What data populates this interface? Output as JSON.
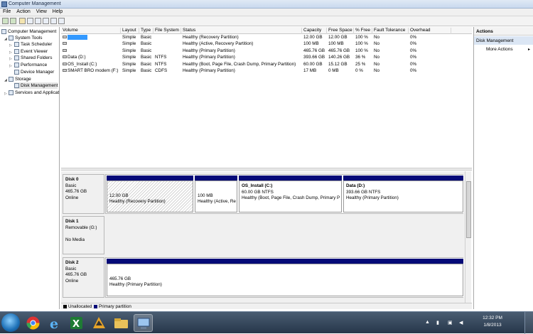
{
  "window": {
    "title": "Computer Management"
  },
  "menu": [
    "File",
    "Action",
    "View",
    "Help"
  ],
  "toolbar": [
    "back-icon",
    "forward-icon",
    "up-icon",
    "properties-icon",
    "help-icon",
    "show-hide-icon",
    "export-icon",
    "refresh-icon"
  ],
  "tree": [
    {
      "label": "Computer Management",
      "level": 0,
      "expanded": true
    },
    {
      "label": "System Tools",
      "level": 1,
      "expanded": true
    },
    {
      "label": "Task Scheduler",
      "level": 2
    },
    {
      "label": "Event Viewer",
      "level": 2
    },
    {
      "label": "Shared Folders",
      "level": 2
    },
    {
      "label": "Performance",
      "level": 2
    },
    {
      "label": "Device Manager",
      "level": 2
    },
    {
      "label": "Storage",
      "level": 1,
      "expanded": true
    },
    {
      "label": "Disk Management",
      "level": 2,
      "selected": true
    },
    {
      "label": "Services and Applicat",
      "level": 1
    }
  ],
  "volume_list": {
    "columns": [
      "Volume",
      "Layout",
      "Type",
      "File System",
      "Status",
      "Capacity",
      "Free Space",
      "% Free",
      "Fault Tolerance",
      "Overhead"
    ],
    "rows": [
      [
        "",
        "Simple",
        "Basic",
        "",
        "Healthy (Recovery Partition)",
        "12.00 GB",
        "12.00 GB",
        "100 %",
        "No",
        "0%"
      ],
      [
        "",
        "Simple",
        "Basic",
        "",
        "Healthy (Active, Recovery Partition)",
        "100 MB",
        "100 MB",
        "100 %",
        "No",
        "0%"
      ],
      [
        "",
        "Simple",
        "Basic",
        "",
        "Healthy (Primary Partition)",
        "465.76 GB",
        "465.76 GB",
        "100 %",
        "No",
        "0%"
      ],
      [
        "Data (D:)",
        "Simple",
        "Basic",
        "NTFS",
        "Healthy (Primary Partition)",
        "393.66 GB",
        "140.26 GB",
        "36 %",
        "No",
        "0%"
      ],
      [
        "OS_Install (C:)",
        "Simple",
        "Basic",
        "NTFS",
        "Healthy (Boot, Page File, Crash Dump, Primary Partition)",
        "60.00 GB",
        "15.12 GB",
        "25 %",
        "No",
        "0%"
      ],
      [
        "SMART BRO modem (F:)",
        "Simple",
        "Basic",
        "CDFS",
        "Healthy (Primary Partition)",
        "17 MB",
        "0 MB",
        "0 %",
        "No",
        "0%"
      ]
    ]
  },
  "disks": [
    {
      "name": "Disk 0",
      "type": "Basic",
      "size": "465.76 GB",
      "status": "Online",
      "volumes": [
        {
          "title": "",
          "size": "12.00 GB",
          "status": "Healthy (Recovery Partition)",
          "selected": true
        },
        {
          "title": "",
          "size": "100 MB",
          "status": "Healthy (Active, Re"
        },
        {
          "title": "OS_Install  (C:)",
          "size": "60.00 GB NTFS",
          "status": "Healthy (Boot, Page File, Crash Dump, Primary P"
        },
        {
          "title": "Data  (D:)",
          "size": "393.66 GB NTFS",
          "status": "Healthy (Primary Partition)"
        }
      ]
    },
    {
      "name": "Disk 1",
      "type": "Removable (G:)",
      "size": "",
      "status": "No Media",
      "volumes": []
    },
    {
      "name": "Disk 2",
      "type": "Basic",
      "size": "465.76 GB",
      "status": "Online",
      "volumes": [
        {
          "title": "",
          "size": "465.76 GB",
          "status": "Healthy (Primary Partition)"
        }
      ]
    }
  ],
  "legend": [
    {
      "label": "Unallocated",
      "color": "#000000"
    },
    {
      "label": "Primary partition",
      "color": "#050a78"
    }
  ],
  "actions": {
    "header": "Actions",
    "section": "Disk Management",
    "item": "More Actions",
    "arrow": "▸"
  },
  "taskbar": {
    "apps": [
      "chrome-icon",
      "internet-explorer-icon",
      "excel-icon",
      "winamp-icon",
      "windows-explorer-icon",
      "computer-management-icon"
    ],
    "time": "12:32 PM",
    "date": "1/8/2013",
    "tray_icons": [
      "arrow-up-icon",
      "signal-icon",
      "network-icon",
      "volume-icon"
    ]
  },
  "colors": {
    "primary_partition": "#050a78",
    "selected_row": "#3399ff"
  }
}
